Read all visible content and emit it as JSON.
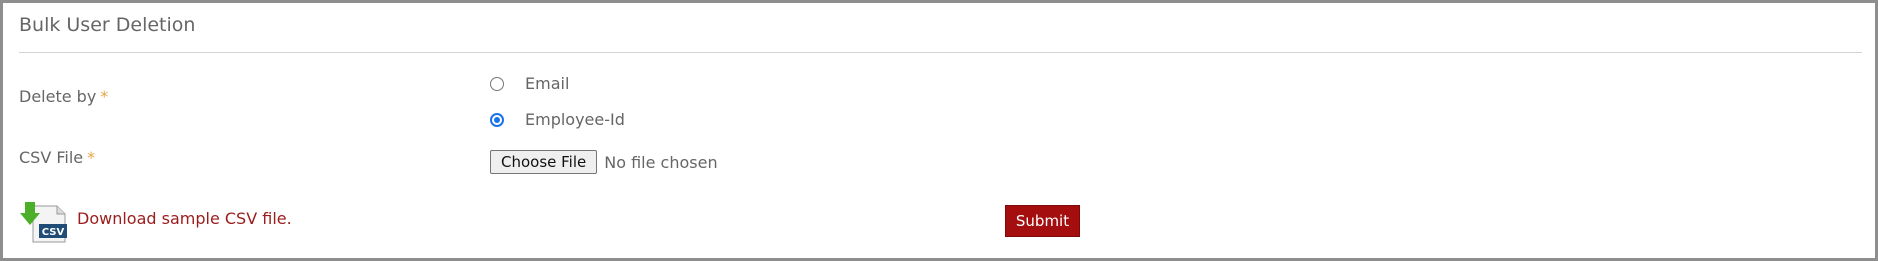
{
  "panel": {
    "title": "Bulk User Deletion"
  },
  "form": {
    "delete_by": {
      "label": "Delete by",
      "required_mark": "*",
      "options": [
        {
          "label": "Email",
          "checked": false
        },
        {
          "label": "Employee-Id",
          "checked": true
        }
      ]
    },
    "csv_file": {
      "label": "CSV File",
      "required_mark": "*",
      "button_label": "Choose File",
      "status": "No file chosen"
    },
    "download": {
      "icon": "csv-download-icon",
      "icon_text": "CSV",
      "link_text": "Download sample CSV file."
    },
    "submit_label": "Submit"
  },
  "colors": {
    "required": "#e5a64a",
    "link": "#9b1c1c",
    "submit_bg": "#a50e0e",
    "radio_checked": "#1a73e8"
  }
}
